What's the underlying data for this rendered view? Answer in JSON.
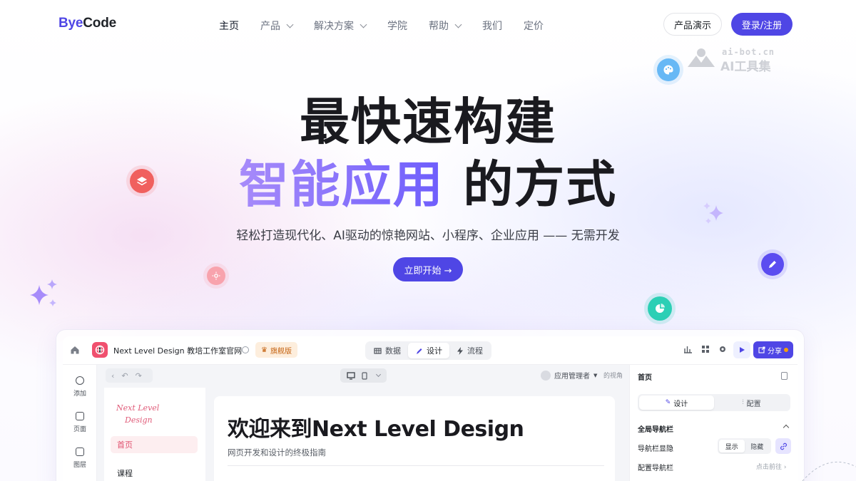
{
  "nav": {
    "logo_a": "Bye",
    "logo_b": "Code",
    "items": [
      {
        "label": "主页",
        "dropdown": false,
        "active": true
      },
      {
        "label": "产品",
        "dropdown": true
      },
      {
        "label": "解决方案",
        "dropdown": true
      },
      {
        "label": "学院",
        "dropdown": false
      },
      {
        "label": "帮助",
        "dropdown": true
      },
      {
        "label": "我们",
        "dropdown": false
      },
      {
        "label": "定价",
        "dropdown": false
      }
    ],
    "demo_label": "产品演示",
    "login_label": "登录/注册"
  },
  "watermark": {
    "line1": "ai-bot.cn",
    "line2": "AI工具集"
  },
  "hero": {
    "title_line1": "最快速构建",
    "title_highlight": "智能应用",
    "title_rest": "的方式",
    "subtitle": "轻松打造现代化、AI驱动的惊艳网站、小程序、企业应用 —— 无需开发",
    "cta_label": "立即开始 →"
  },
  "app": {
    "title": "Next Level Design 教培工作室官网",
    "badge": "旗舰版",
    "tabs": [
      {
        "label": "数据",
        "icon": "table-icon",
        "active": false
      },
      {
        "label": "设计",
        "icon": "brush-icon",
        "active": true
      },
      {
        "label": "流程",
        "icon": "bolt-icon",
        "active": false
      }
    ],
    "share_label": "分享",
    "rail": [
      {
        "label": "添加",
        "icon": "add-icon"
      },
      {
        "label": "页面",
        "icon": "page-icon"
      },
      {
        "label": "图层",
        "icon": "layers-icon"
      }
    ],
    "role_label": "应用管理者",
    "view_label": "的视角",
    "preview": {
      "logo_line1": "Next Level",
      "logo_line2": "Design",
      "nav_home": "首页",
      "nav_course": "课程",
      "heading": "欢迎来到Next Level Design",
      "subheading": "网页开发和设计的终极指南"
    },
    "panel": {
      "title": "首页",
      "seg_design": "设计",
      "seg_config": "配置",
      "section": "全局导航栏",
      "navbar_visibility": "导航栏显隐",
      "show": "显示",
      "hide": "隐藏",
      "configure_nav": "配置导航栏",
      "goto": "点击前往 ›"
    }
  },
  "colors": {
    "brand": "#4f46e5",
    "gradient_start": "#a78bfa",
    "gradient_end": "#6d5dfc",
    "badge_bg": "#fdeedd",
    "accent_pink": "#f0506e"
  }
}
